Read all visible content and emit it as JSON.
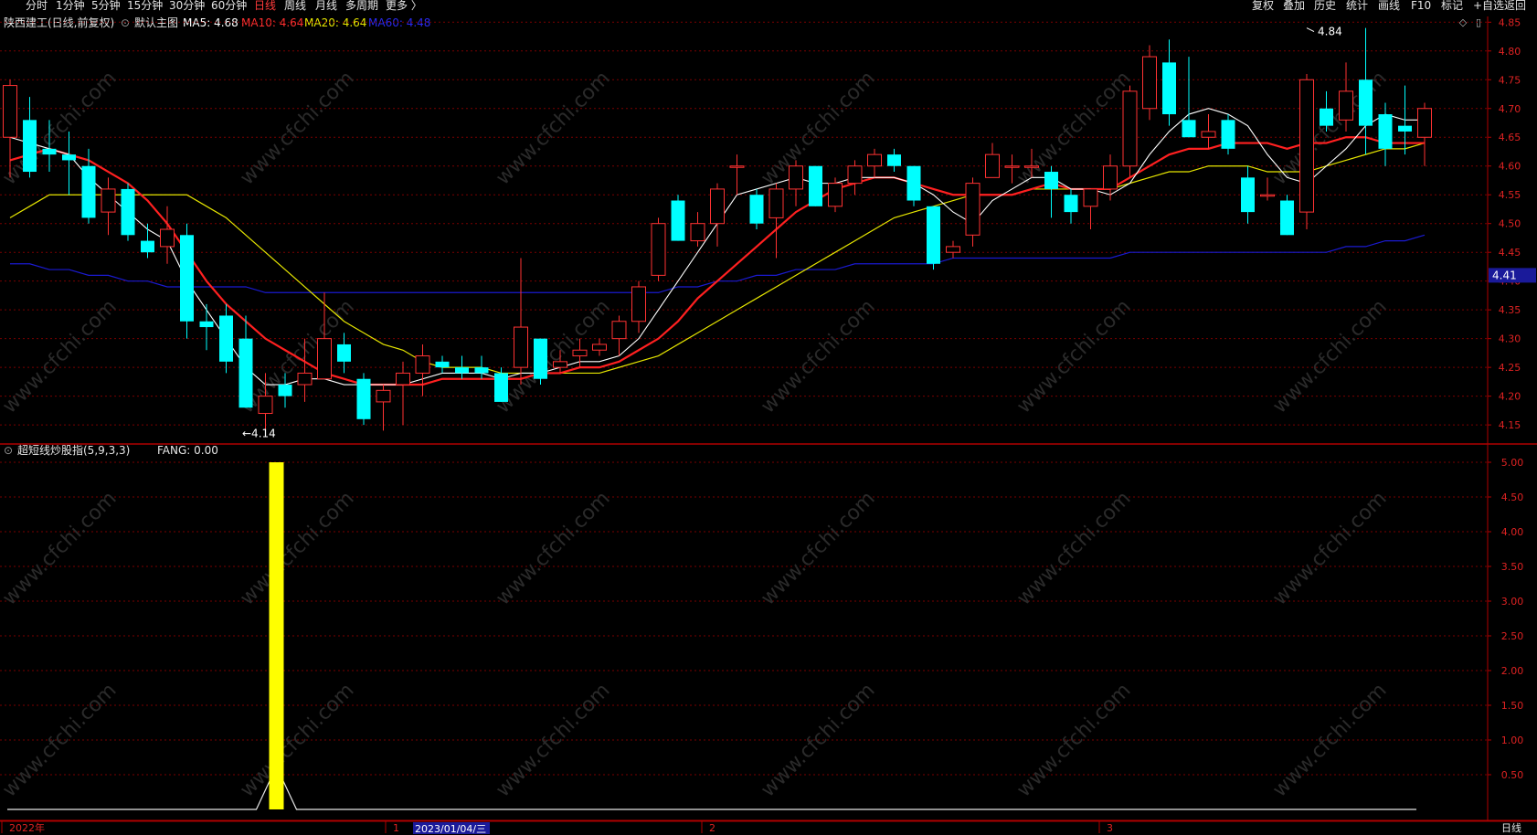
{
  "toolbar": {
    "left_items": [
      "分时",
      "1分钟",
      "5分钟",
      "15分钟",
      "30分钟",
      "60分钟",
      "日线",
      "周线",
      "月线",
      "多周期",
      "更多 〉"
    ],
    "active": "日线",
    "right_items": [
      "复权",
      "叠加",
      "历史",
      "统计",
      "画线",
      "F10",
      "标记",
      "+自选",
      "返回"
    ]
  },
  "header": {
    "stock_title": "陕西建工(日线,前复权)",
    "main_chart_name": "默认主图",
    "ma5_label": "MA5: 4.68",
    "ma10_label": "MA10: 4.64",
    "ma20_label": "MA20: 4.64",
    "ma60_label": "MA60: 4.48"
  },
  "indicator": {
    "name": "超短线炒股指(5,9,3,3)",
    "value_label": "FANG: 0.00"
  },
  "colors": {
    "up": "#ff3232",
    "down": "#00ffff",
    "ma5": "#ffffff",
    "ma10": "#ff2020",
    "ma20": "#e6e600",
    "ma60": "#1a1ad0",
    "grid": "#7a0000",
    "indicator_bar": "#ffff00"
  },
  "watermark": "www.cfchi.com",
  "price_axis": [
    "4.85",
    "4.80",
    "4.75",
    "4.70",
    "4.65",
    "4.60",
    "4.55",
    "4.50",
    "4.45",
    "4.40",
    "4.35",
    "4.30",
    "4.25",
    "4.20",
    "4.15"
  ],
  "indicator_axis": [
    "5.00",
    "4.50",
    "4.00",
    "3.50",
    "3.00",
    "2.50",
    "2.00",
    "1.50",
    "1.00",
    "0.50"
  ],
  "current_price_tag": "4.41",
  "bottom_axis": {
    "year": "2022年",
    "m1": "1",
    "date_highlight": "2023/01/04/三",
    "m2": "2",
    "m3": "3",
    "period": "日线"
  },
  "chart_data": [
    {
      "type": "candlestick",
      "title": "陕西建工(日线,前复权)",
      "ylim": [
        4.12,
        4.86
      ],
      "annotations": [
        {
          "text": "4.84",
          "kind": "high",
          "index": 66,
          "value": 4.84
        },
        {
          "text": "4.14",
          "kind": "low",
          "index": 12,
          "value": 4.14
        }
      ],
      "ohlc": [
        [
          4.65,
          4.75,
          4.58,
          4.74
        ],
        [
          4.68,
          4.72,
          4.58,
          4.59
        ],
        [
          4.63,
          4.68,
          4.59,
          4.62
        ],
        [
          4.62,
          4.66,
          4.55,
          4.61
        ],
        [
          4.6,
          4.63,
          4.5,
          4.51
        ],
        [
          4.52,
          4.58,
          4.48,
          4.56
        ],
        [
          4.56,
          4.57,
          4.47,
          4.48
        ],
        [
          4.47,
          4.5,
          4.44,
          4.45
        ],
        [
          4.46,
          4.53,
          4.43,
          4.49
        ],
        [
          4.48,
          4.5,
          4.3,
          4.33
        ],
        [
          4.33,
          4.36,
          4.28,
          4.32
        ],
        [
          4.34,
          4.36,
          4.24,
          4.26
        ],
        [
          4.3,
          4.34,
          4.18,
          4.18
        ],
        [
          4.17,
          4.24,
          4.14,
          4.2
        ],
        [
          4.22,
          4.24,
          4.18,
          4.2
        ],
        [
          4.22,
          4.3,
          4.19,
          4.24
        ],
        [
          4.23,
          4.38,
          4.23,
          4.3
        ],
        [
          4.29,
          4.31,
          4.24,
          4.26
        ],
        [
          4.23,
          4.24,
          4.15,
          4.16
        ],
        [
          4.19,
          4.22,
          4.14,
          4.21
        ],
        [
          4.22,
          4.26,
          4.15,
          4.24
        ],
        [
          4.24,
          4.29,
          4.2,
          4.27
        ],
        [
          4.26,
          4.27,
          4.24,
          4.25
        ],
        [
          4.25,
          4.27,
          4.23,
          4.24
        ],
        [
          4.25,
          4.27,
          4.23,
          4.24
        ],
        [
          4.24,
          4.25,
          4.19,
          4.19
        ],
        [
          4.25,
          4.44,
          4.22,
          4.32
        ],
        [
          4.3,
          4.3,
          4.22,
          4.23
        ],
        [
          4.25,
          4.28,
          4.24,
          4.26
        ],
        [
          4.27,
          4.3,
          4.25,
          4.28
        ],
        [
          4.28,
          4.3,
          4.27,
          4.29
        ],
        [
          4.3,
          4.34,
          4.27,
          4.33
        ],
        [
          4.33,
          4.4,
          4.31,
          4.39
        ],
        [
          4.41,
          4.51,
          4.4,
          4.5
        ],
        [
          4.54,
          4.55,
          4.47,
          4.47
        ],
        [
          4.47,
          4.52,
          4.46,
          4.5
        ],
        [
          4.5,
          4.57,
          4.46,
          4.56
        ],
        [
          4.6,
          4.62,
          4.55,
          4.6
        ],
        [
          4.55,
          4.56,
          4.49,
          4.5
        ],
        [
          4.51,
          4.57,
          4.44,
          4.56
        ],
        [
          4.56,
          4.61,
          4.53,
          4.6
        ],
        [
          4.6,
          4.6,
          4.53,
          4.53
        ],
        [
          4.53,
          4.58,
          4.52,
          4.57
        ],
        [
          4.57,
          4.61,
          4.55,
          4.6
        ],
        [
          4.6,
          4.63,
          4.58,
          4.62
        ],
        [
          4.62,
          4.63,
          4.59,
          4.6
        ],
        [
          4.6,
          4.6,
          4.53,
          4.54
        ],
        [
          4.53,
          4.53,
          4.42,
          4.43
        ],
        [
          4.45,
          4.47,
          4.44,
          4.46
        ],
        [
          4.48,
          4.58,
          4.46,
          4.57
        ],
        [
          4.58,
          4.64,
          4.58,
          4.62
        ],
        [
          4.6,
          4.62,
          4.57,
          4.6
        ],
        [
          4.6,
          4.63,
          4.58,
          4.6
        ],
        [
          4.59,
          4.6,
          4.51,
          4.56
        ],
        [
          4.55,
          4.56,
          4.5,
          4.52
        ],
        [
          4.53,
          4.56,
          4.49,
          4.56
        ],
        [
          4.56,
          4.62,
          4.54,
          4.6
        ],
        [
          4.6,
          4.74,
          4.58,
          4.73
        ],
        [
          4.7,
          4.81,
          4.68,
          4.79
        ],
        [
          4.78,
          4.82,
          4.67,
          4.69
        ],
        [
          4.68,
          4.79,
          4.66,
          4.65
        ],
        [
          4.65,
          4.69,
          4.63,
          4.66
        ],
        [
          4.68,
          4.69,
          4.62,
          4.63
        ],
        [
          4.58,
          4.6,
          4.5,
          4.52
        ],
        [
          4.55,
          4.58,
          4.54,
          4.55
        ],
        [
          4.54,
          4.55,
          4.48,
          4.48
        ],
        [
          4.52,
          4.76,
          4.49,
          4.75
        ],
        [
          4.7,
          4.73,
          4.66,
          4.67
        ],
        [
          4.68,
          4.78,
          4.66,
          4.73
        ],
        [
          4.75,
          4.84,
          4.62,
          4.67
        ],
        [
          4.69,
          4.71,
          4.6,
          4.63
        ],
        [
          4.67,
          4.74,
          4.62,
          4.66
        ],
        [
          4.65,
          4.71,
          4.6,
          4.7
        ]
      ],
      "ma": {
        "MA5": [
          4.65,
          4.64,
          4.63,
          4.62,
          4.58,
          4.55,
          4.52,
          4.49,
          4.47,
          4.4,
          4.35,
          4.3,
          4.25,
          4.22,
          4.22,
          4.23,
          4.23,
          4.22,
          4.22,
          4.22,
          4.22,
          4.23,
          4.24,
          4.24,
          4.24,
          4.23,
          4.24,
          4.24,
          4.25,
          4.26,
          4.26,
          4.27,
          4.3,
          4.35,
          4.4,
          4.45,
          4.5,
          4.55,
          4.56,
          4.57,
          4.58,
          4.57,
          4.57,
          4.58,
          4.58,
          4.58,
          4.57,
          4.55,
          4.52,
          4.5,
          4.54,
          4.56,
          4.58,
          4.58,
          4.56,
          4.56,
          4.55,
          4.57,
          4.62,
          4.66,
          4.69,
          4.7,
          4.69,
          4.67,
          4.62,
          4.58,
          4.57,
          4.6,
          4.63,
          4.67,
          4.69,
          4.68,
          4.68
        ],
        "MA10": [
          4.61,
          4.62,
          4.63,
          4.62,
          4.61,
          4.59,
          4.57,
          4.54,
          4.5,
          4.45,
          4.4,
          4.36,
          4.33,
          4.3,
          4.28,
          4.26,
          4.24,
          4.23,
          4.22,
          4.22,
          4.22,
          4.22,
          4.23,
          4.23,
          4.23,
          4.23,
          4.23,
          4.24,
          4.24,
          4.25,
          4.25,
          4.26,
          4.28,
          4.3,
          4.33,
          4.37,
          4.4,
          4.43,
          4.46,
          4.49,
          4.52,
          4.54,
          4.56,
          4.57,
          4.58,
          4.58,
          4.57,
          4.56,
          4.55,
          4.55,
          4.55,
          4.55,
          4.56,
          4.57,
          4.56,
          4.56,
          4.56,
          4.58,
          4.6,
          4.62,
          4.63,
          4.63,
          4.64,
          4.64,
          4.64,
          4.63,
          4.64,
          4.64,
          4.65,
          4.65,
          4.64,
          4.64,
          4.64
        ],
        "MA20": [
          4.51,
          4.53,
          4.55,
          4.55,
          4.55,
          4.55,
          4.55,
          4.55,
          4.55,
          4.55,
          4.53,
          4.51,
          4.48,
          4.45,
          4.42,
          4.39,
          4.36,
          4.33,
          4.31,
          4.29,
          4.28,
          4.26,
          4.25,
          4.25,
          4.25,
          4.24,
          4.24,
          4.24,
          4.24,
          4.24,
          4.24,
          4.25,
          4.26,
          4.27,
          4.29,
          4.31,
          4.33,
          4.35,
          4.37,
          4.39,
          4.41,
          4.43,
          4.45,
          4.47,
          4.49,
          4.51,
          4.52,
          4.53,
          4.54,
          4.55,
          4.55,
          4.55,
          4.56,
          4.56,
          4.56,
          4.56,
          4.56,
          4.57,
          4.58,
          4.59,
          4.59,
          4.6,
          4.6,
          4.6,
          4.59,
          4.59,
          4.59,
          4.6,
          4.61,
          4.62,
          4.63,
          4.63,
          4.64
        ],
        "MA60": [
          4.43,
          4.43,
          4.42,
          4.42,
          4.41,
          4.41,
          4.4,
          4.4,
          4.39,
          4.39,
          4.39,
          4.39,
          4.39,
          4.38,
          4.38,
          4.38,
          4.38,
          4.38,
          4.38,
          4.38,
          4.38,
          4.38,
          4.38,
          4.38,
          4.38,
          4.38,
          4.38,
          4.38,
          4.38,
          4.38,
          4.38,
          4.38,
          4.38,
          4.38,
          4.39,
          4.39,
          4.4,
          4.4,
          4.41,
          4.41,
          4.42,
          4.42,
          4.42,
          4.43,
          4.43,
          4.43,
          4.43,
          4.43,
          4.44,
          4.44,
          4.44,
          4.44,
          4.44,
          4.44,
          4.44,
          4.44,
          4.44,
          4.45,
          4.45,
          4.45,
          4.45,
          4.45,
          4.45,
          4.45,
          4.45,
          4.45,
          4.45,
          4.45,
          4.46,
          4.46,
          4.47,
          4.47,
          4.48
        ]
      }
    },
    {
      "type": "bar",
      "title": "超短线炒股指(5,9,3,3)",
      "ylim": [
        0,
        5.0
      ],
      "series": [
        {
          "name": "FANG",
          "bars": [
            {
              "index": 13,
              "value": 5.0
            }
          ]
        }
      ],
      "baseline_spike": {
        "index": 13,
        "value": 0.62
      }
    }
  ]
}
